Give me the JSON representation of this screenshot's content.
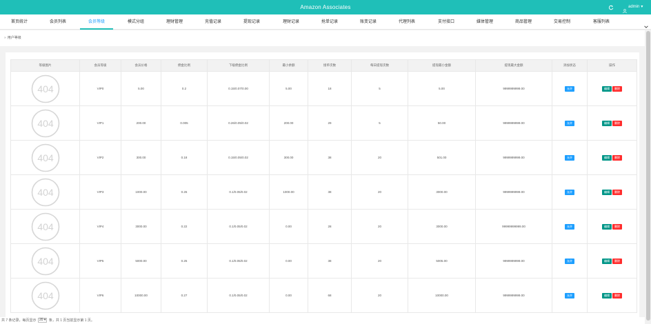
{
  "header": {
    "title": "Amazon Associates",
    "user": "admin",
    "refresh_icon": "refresh-icon",
    "user_icon": "person-icon"
  },
  "nav": {
    "tabs": [
      {
        "label": "首页统计"
      },
      {
        "label": "会员列表"
      },
      {
        "label": "会员等级",
        "active": true
      },
      {
        "label": "模式分组"
      },
      {
        "label": "理财管理"
      },
      {
        "label": "充值记录"
      },
      {
        "label": "提现记录"
      },
      {
        "label": "理财记录"
      },
      {
        "label": "抢单记录"
      },
      {
        "label": "账变记录"
      },
      {
        "label": "代理列表"
      },
      {
        "label": "支付接口"
      },
      {
        "label": "媒体管理"
      },
      {
        "label": "商品管理"
      },
      {
        "label": "交易控制"
      },
      {
        "label": "客服列表"
      }
    ]
  },
  "breadcrumb": {
    "sep": "»",
    "label": "用户等级"
  },
  "table": {
    "headers": [
      "等级图片",
      "会员等级",
      "会员价格",
      "佣金比例",
      "下级佣金比例",
      "最小余额",
      "接单次数",
      "每日提现次数",
      "提现最小金额",
      "提现最大金额",
      "添加状态",
      "操作"
    ],
    "img_text": "404",
    "status_label": "允许",
    "edit_label": "编辑",
    "delete_label": "删除",
    "rows": [
      {
        "level": "VIP0",
        "price": "5.00",
        "commission": "0.2",
        "sub_commission": "0.15/0.07/0.00",
        "min_balance": "5.00",
        "orders": "18",
        "daily_withdraw": "5",
        "withdraw_min": "5.00",
        "withdraw_max": "9999999999.00"
      },
      {
        "level": "VIP1",
        "price": "200.00",
        "commission": "0.005",
        "sub_commission": "0.26/0.05/0.02",
        "min_balance": "200.00",
        "orders": "29",
        "daily_withdraw": "5",
        "withdraw_min": "50.00",
        "withdraw_max": "9999999999.00"
      },
      {
        "level": "VIP2",
        "price": "300.00",
        "commission": "0.18",
        "sub_commission": "0.15/0.05/0.02",
        "min_balance": "300.00",
        "orders": "38",
        "daily_withdraw": "20",
        "withdraw_min": "501.00",
        "withdraw_max": "9999999999.00"
      },
      {
        "level": "VIP3",
        "price": "1000.00",
        "commission": "0.26",
        "sub_commission": "0.1/0.05/0.02",
        "min_balance": "1000.00",
        "orders": "38",
        "daily_withdraw": "20",
        "withdraw_min": "3000.00",
        "withdraw_max": "9999999999.00"
      },
      {
        "level": "VIP4",
        "price": "3000.00",
        "commission": "0.22",
        "sub_commission": "0.1/0.05/0.02",
        "min_balance": "0.00",
        "orders": "28",
        "daily_withdraw": "20",
        "withdraw_min": "3000.00",
        "withdraw_max": "99999999999.00"
      },
      {
        "level": "VIP5",
        "price": "5000.00",
        "commission": "0.25",
        "sub_commission": "0.1/0.05/0.02",
        "min_balance": "0.00",
        "orders": "38",
        "daily_withdraw": "20",
        "withdraw_min": "5005.00",
        "withdraw_max": "9999999999.00"
      },
      {
        "level": "VIP6",
        "price": "10000.00",
        "commission": "0.27",
        "sub_commission": "0.1/0.05/0.02",
        "min_balance": "0.00",
        "orders": "68",
        "daily_withdraw": "20",
        "withdraw_min": "10000.00",
        "withdraw_max": "9999999999.00"
      }
    ]
  },
  "pager": {
    "prefix": "共 7 条记录，每页显示",
    "page_size": "20",
    "suffix": "条，共 1 页当前显示第 1 页。"
  },
  "colors": {
    "topbar": "#1fbfb8",
    "price": "#5fb878",
    "status_btn": "#1e9fff",
    "edit_btn": "#009688",
    "delete_btn": "#ff2d2d",
    "active_tab": "#1e9fff"
  }
}
